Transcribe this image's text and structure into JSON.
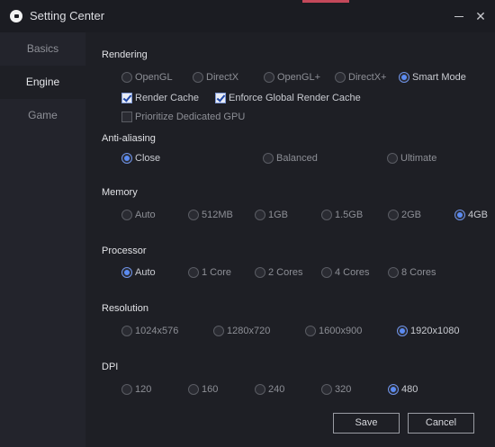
{
  "window": {
    "title": "Setting Center",
    "close_glyph": "✕"
  },
  "sidebar": {
    "items": [
      {
        "label": "Basics"
      },
      {
        "label": "Engine"
      },
      {
        "label": "Game"
      }
    ]
  },
  "rendering": {
    "title": "Rendering",
    "options": [
      "OpenGL",
      "DirectX",
      "OpenGL+",
      "DirectX+",
      "Smart Mode"
    ],
    "selected": "Smart Mode",
    "checkboxes": [
      {
        "label": "Render Cache",
        "checked": true
      },
      {
        "label": "Enforce Global Render Cache",
        "checked": true
      },
      {
        "label": "Prioritize Dedicated GPU",
        "checked": false
      }
    ]
  },
  "anti_aliasing": {
    "title": "Anti-aliasing",
    "options": [
      "Close",
      "Balanced",
      "Ultimate"
    ],
    "selected": "Close"
  },
  "memory": {
    "title": "Memory",
    "options": [
      "Auto",
      "512MB",
      "1GB",
      "1.5GB",
      "2GB",
      "4GB"
    ],
    "selected": "4GB"
  },
  "processor": {
    "title": "Processor",
    "options": [
      "Auto",
      "1 Core",
      "2 Cores",
      "4 Cores",
      "8 Cores"
    ],
    "selected": "Auto"
  },
  "resolution": {
    "title": "Resolution",
    "options": [
      "1024x576",
      "1280x720",
      "1600x900",
      "1920x1080"
    ],
    "selected": "1920x1080"
  },
  "dpi": {
    "title": "DPI",
    "options": [
      "120",
      "160",
      "240",
      "320",
      "480"
    ],
    "selected": "480"
  },
  "buttons": {
    "save": "Save",
    "cancel": "Cancel"
  },
  "colors": {
    "accent": "#5b8bf2",
    "background": "#1e1f25",
    "sidebar": "#23242c"
  }
}
